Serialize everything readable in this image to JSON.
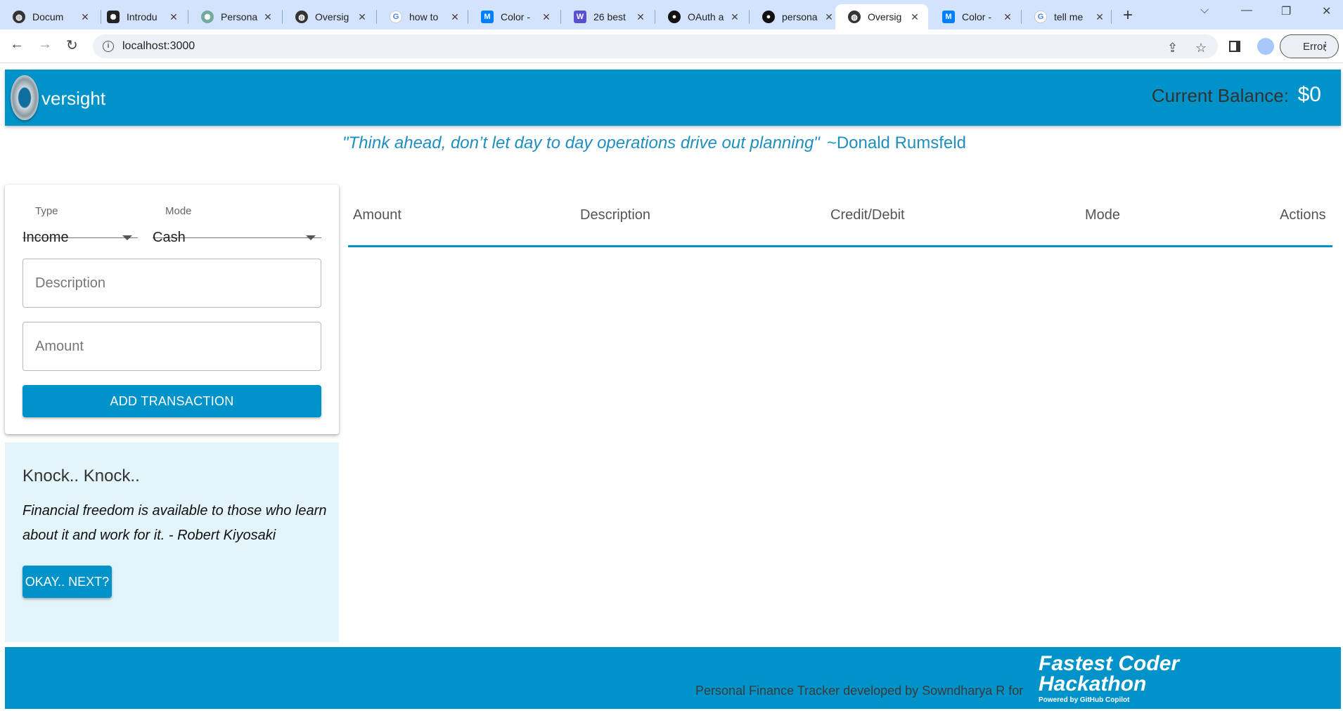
{
  "browser": {
    "tabs": [
      {
        "title": "Docum",
        "favicon": "globe-icon",
        "active": false
      },
      {
        "title": "Introdu",
        "favicon": "openai-icon",
        "active": false
      },
      {
        "title": "Persona",
        "favicon": "chatgpt-icon",
        "active": false
      },
      {
        "title": "Oversig",
        "favicon": "globe-icon",
        "active": false
      },
      {
        "title": "how to",
        "favicon": "google-icon",
        "active": false
      },
      {
        "title": "Color -",
        "favicon": "mui-icon",
        "active": false
      },
      {
        "title": "26 best",
        "favicon": "w-icon",
        "active": false
      },
      {
        "title": "OAuth a",
        "favicon": "github-icon",
        "active": false
      },
      {
        "title": "persona",
        "favicon": "github-icon",
        "active": false
      },
      {
        "title": "Oversig",
        "favicon": "globe-icon",
        "active": true
      },
      {
        "title": "Color -",
        "favicon": "mui-icon",
        "active": false
      },
      {
        "title": "tell me",
        "favicon": "google-icon",
        "active": false
      }
    ],
    "url": "localhost:3000",
    "profile_status": "Error"
  },
  "app": {
    "logo_letter": "O",
    "logo_text": "versight",
    "balance_label": "Current Balance:",
    "balance_value": "$0",
    "quote_text": "\"Think ahead, don’t let day to day operations drive out planning\"",
    "quote_author": "~Donald Rumsfeld",
    "form": {
      "type_label": "Type",
      "type_value": "Income",
      "mode_label": "Mode",
      "mode_value": "Cash",
      "description_placeholder": "Description",
      "amount_placeholder": "Amount",
      "submit_label": "ADD TRANSACTION"
    },
    "knock": {
      "title": "Knock.. Knock..",
      "quote": "Financial freedom is available to those who learn about it and work for it. - Robert Kiyosaki",
      "button_label": "OKAY.. NEXT?"
    },
    "table": {
      "columns": [
        "Amount",
        "Description",
        "Credit/Debit",
        "Mode",
        "Actions"
      ],
      "rows": []
    },
    "footer": {
      "credit": "Personal Finance Tracker developed by Sowndharya R for",
      "hackathon_line1": "Fastest Coder",
      "hackathon_line2": "Hackathon",
      "hackathon_powered": "Powered by GitHub Copilot"
    },
    "colors": {
      "primary": "#0093ca",
      "knock_bg": "#e3f4fb",
      "quote": "#1f8fc0"
    }
  }
}
